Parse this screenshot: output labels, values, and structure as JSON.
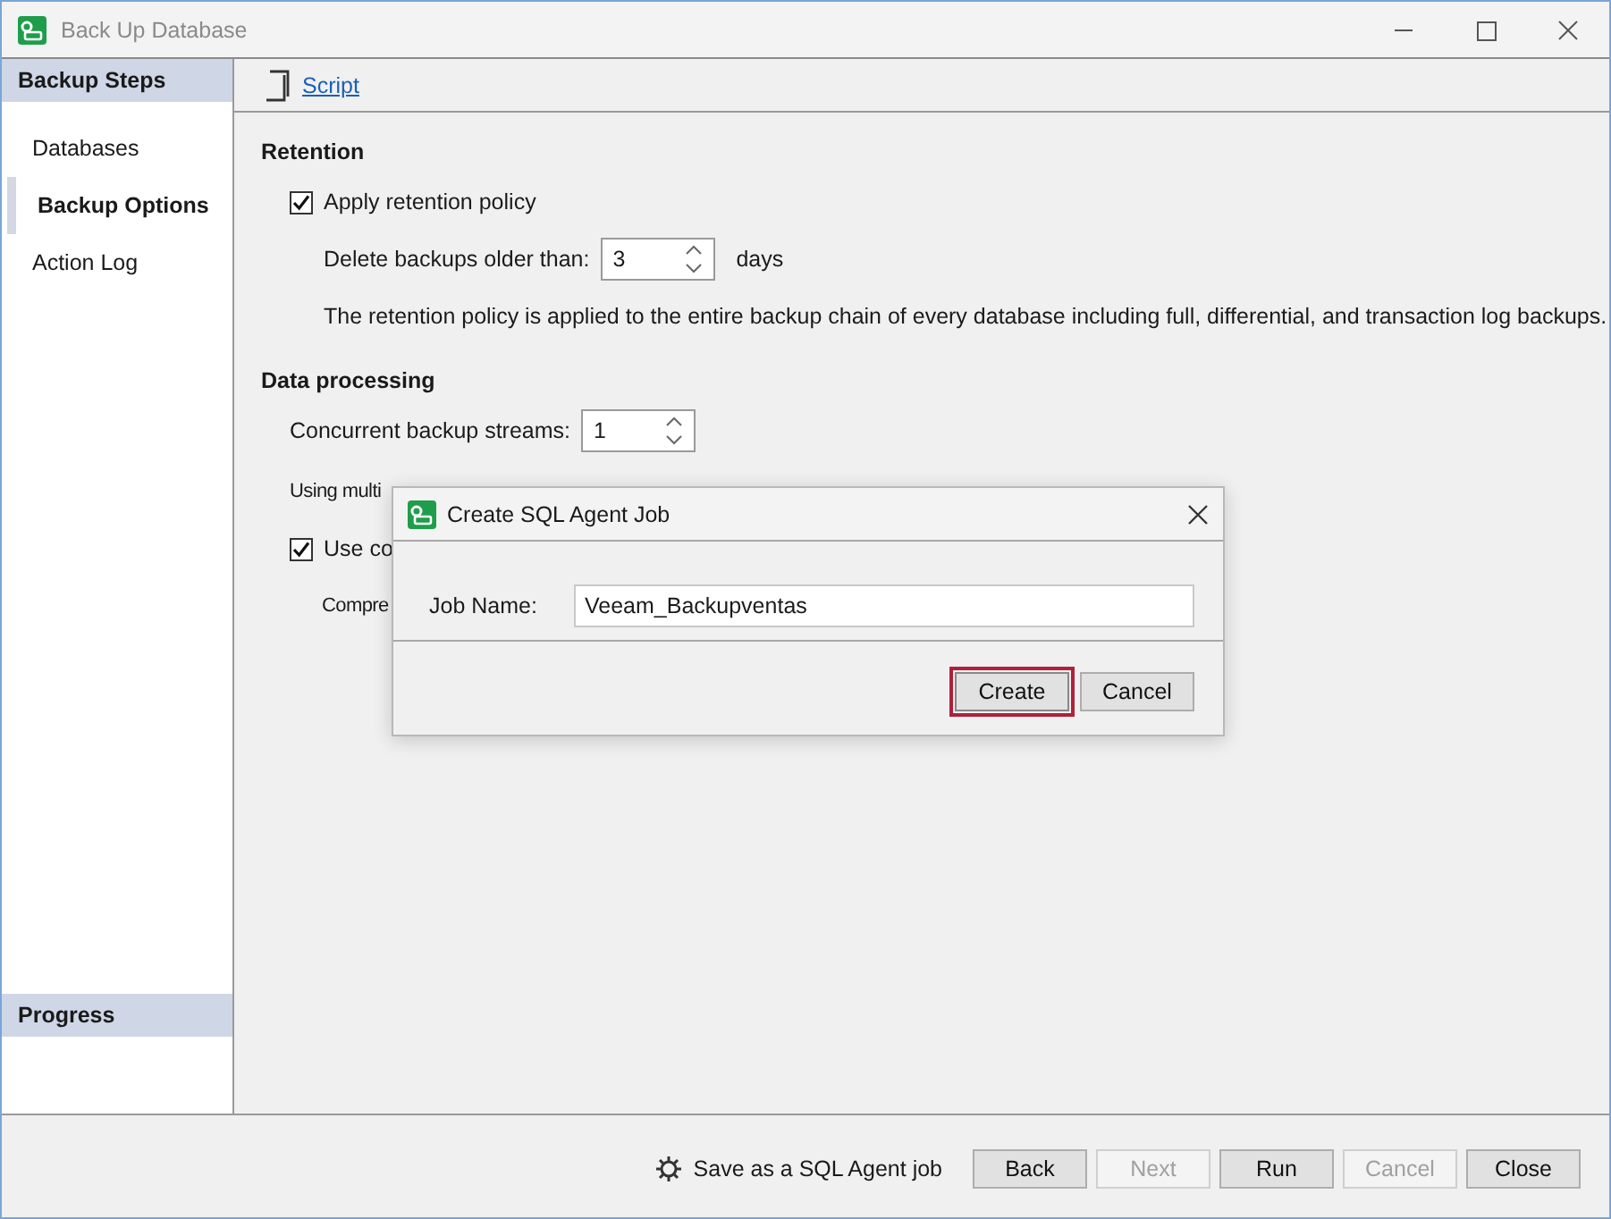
{
  "window": {
    "title": "Back Up Database"
  },
  "sidebar": {
    "title": "Backup Steps",
    "items": [
      {
        "label": "Databases",
        "selected": false
      },
      {
        "label": "Backup Options",
        "selected": true
      },
      {
        "label": "Action Log",
        "selected": false
      }
    ],
    "footer": "Progress"
  },
  "toolbar": {
    "link": "Script"
  },
  "retention": {
    "heading": "Retention",
    "apply": {
      "label": "Apply retention policy",
      "checked": true
    },
    "delete_label": "Delete backups older than:",
    "delete_value": "3",
    "unit": "days",
    "note": "The retention policy is applied to the entire backup chain of every database including full, differential, and transaction log backups."
  },
  "data_processing": {
    "heading": "Data processing",
    "streams_label": "Concurrent backup streams:",
    "streams_value": "1",
    "note": "Using multi",
    "compression": {
      "label": "Use co",
      "checked": true
    },
    "compression_level_label": "Compre"
  },
  "dialog": {
    "title": "Create SQL Agent Job",
    "field_label": "Job Name:",
    "field_value": "Veeam_Backupventas",
    "buttons": [
      {
        "label": "Create",
        "focused": true
      },
      {
        "label": "Cancel",
        "focused": false
      }
    ]
  },
  "footer": {
    "save_job": "Save as a SQL Agent job",
    "buttons": [
      {
        "label": "Back",
        "disabled": false
      },
      {
        "label": "Next",
        "disabled": true
      },
      {
        "label": "Run",
        "disabled": false
      },
      {
        "label": "Cancel",
        "disabled": true
      },
      {
        "label": "Close",
        "disabled": false
      }
    ]
  }
}
